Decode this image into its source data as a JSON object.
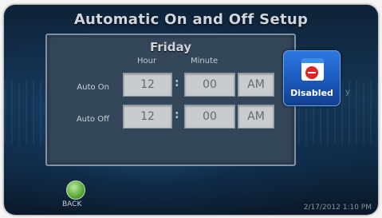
{
  "screen": {
    "title": "Automatic On and Off Setup",
    "day": "Friday",
    "columns": {
      "hour": "Hour",
      "minute": "Minute"
    },
    "rows": [
      {
        "label": "Auto On",
        "hour": "12",
        "minute": "00",
        "ampm": "AM"
      },
      {
        "label": "Auto Off",
        "hour": "12",
        "minute": "00",
        "ampm": "AM"
      }
    ],
    "separator": ":",
    "disabled_button": {
      "label": "Disabled",
      "icon": "calendar-no-icon"
    },
    "back_button": {
      "label": "BACK",
      "icon": "back-icon"
    },
    "edge_text": "y",
    "datetime": "2/17/2012 1:10 PM"
  },
  "colors": {
    "panel": "#34465a",
    "button": "#1a56b8",
    "field": "#c9ccce"
  }
}
